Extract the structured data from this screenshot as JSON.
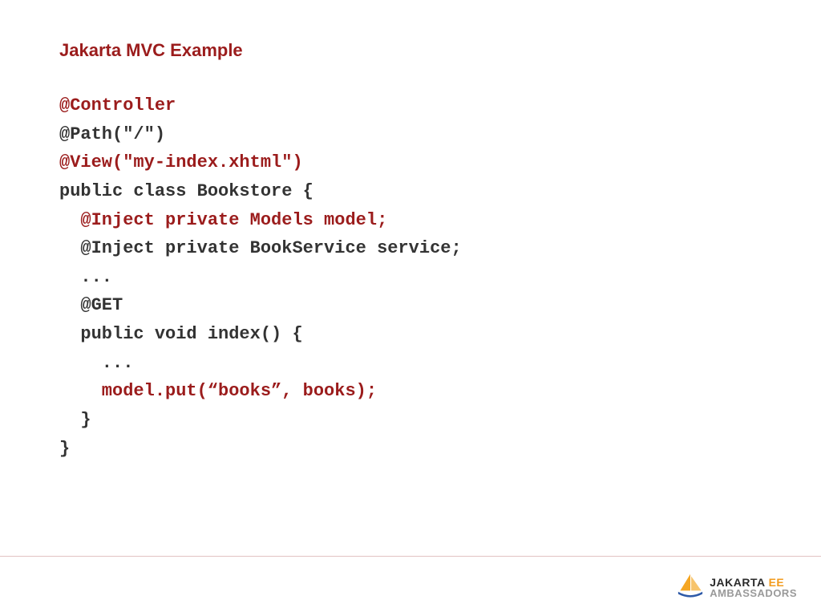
{
  "title": "Jakarta MVC Example",
  "code": {
    "l1": "@Controller",
    "l2": "@Path(\"/\")",
    "l3": "@View(\"my-index.xhtml\")",
    "l4": "public class Bookstore {",
    "l5": "  @Inject private Models model;",
    "l6": "  @Inject private BookService service;",
    "l7": "  ...",
    "l8": "  @GET",
    "l9": "  public void index() {",
    "l10": "    ...",
    "l11": "    model.put(“books”, books);",
    "l12": "  }",
    "l13": "}"
  },
  "logo": {
    "top1": "JAKARTA",
    "top2": "EE",
    "bottom": "AMBASSADORS"
  }
}
